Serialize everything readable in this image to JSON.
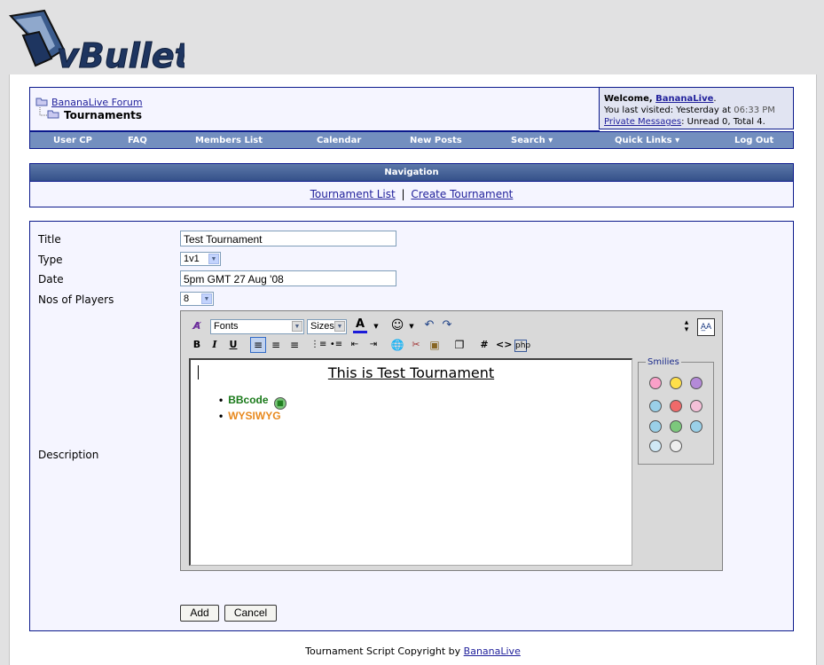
{
  "logo": {
    "text": "vBulletin"
  },
  "breadcrumb": {
    "forum": "BananaLive Forum",
    "current": "Tournaments"
  },
  "welcome": {
    "prefix": "Welcome, ",
    "user": "BananaLive",
    "suffix": ".",
    "last_visited_prefix": "You last visited: Yesterday at ",
    "last_visited_time": "06:33 PM",
    "pm_link": "Private Messages",
    "pm_info": ": Unread 0, Total 4."
  },
  "navbar": [
    "User CP",
    "FAQ",
    "Members List",
    "Calendar",
    "New Posts",
    "Search ▾",
    "Quick Links ▾",
    "Log Out"
  ],
  "navigation": {
    "title": "Navigation",
    "link1": "Tournament List",
    "sep": "|",
    "link2": "Create Tournament"
  },
  "form": {
    "title_label": "Title",
    "title_value": "Test Tournament",
    "type_label": "Type",
    "type_value": "1v1",
    "date_label": "Date",
    "date_value": "5pm GMT 27 Aug '08",
    "players_label": "Nos of Players",
    "players_value": "8",
    "description_label": "Description"
  },
  "editor": {
    "fonts": "Fonts",
    "sizes": "Sizes",
    "bold": "B",
    "italic": "I",
    "underline": "U",
    "heading": "This is Test Tournament",
    "bullet1": "BBcode",
    "bullet2": "WYSIWYG",
    "smilies_title": "Smilies"
  },
  "buttons": {
    "add": "Add",
    "cancel": "Cancel"
  },
  "footer": {
    "text": "Tournament Script Copyright by ",
    "link": "BananaLive"
  },
  "colors": {
    "accent": "#738fbf",
    "header": "#3e5c92",
    "border": "#0b198c",
    "bbcode": "#1a7a1a",
    "wysiwyg": "#e8891e"
  }
}
